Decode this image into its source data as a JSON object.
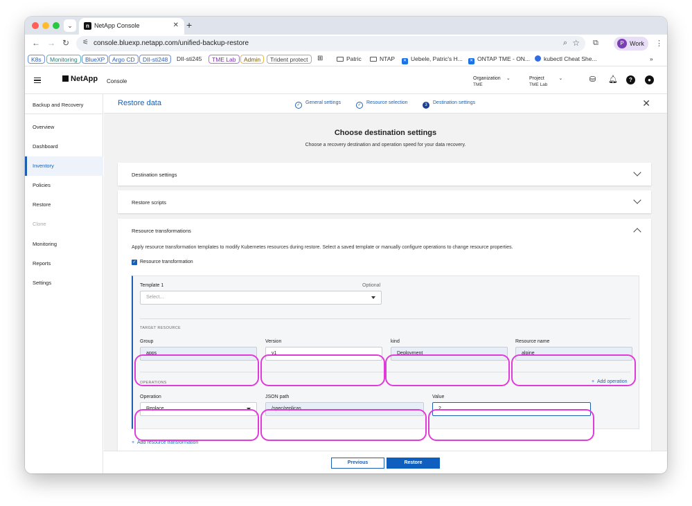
{
  "browser": {
    "tab_title": "NetApp Console",
    "url": "console.bluexp.netapp.com/unified-backup-restore",
    "profile_initial": "P",
    "profile_name": "Work",
    "bookmarks": [
      "K8s",
      "Monitoring",
      "BlueXP",
      "Argo CD",
      "DII-sti248",
      "DII-sti245",
      "TME Lab",
      "Admin",
      "Trident protect",
      "Patric",
      "NTAP",
      "Uebele, Patric's H...",
      "ONTAP TME - ON...",
      "kubectl Cheat She..."
    ]
  },
  "header": {
    "logo": "NetApp",
    "app_name": "Console",
    "organization_label": "Organization",
    "organization_value": "TME",
    "project_label": "Project",
    "project_value": "TME Lab"
  },
  "sidebar": {
    "title": "Backup and Recovery",
    "items": [
      "Overview",
      "Dashboard",
      "Inventory",
      "Policies",
      "Restore",
      "Clone",
      "Monitoring",
      "Reports",
      "Settings"
    ],
    "active": "Inventory",
    "disabled": "Clone"
  },
  "wizard": {
    "title": "Restore data",
    "steps": [
      {
        "label": "General settings",
        "state": "done"
      },
      {
        "label": "Resource selection",
        "state": "done"
      },
      {
        "label": "Destination settings",
        "state": "current",
        "number": "3"
      }
    ]
  },
  "content": {
    "heading": "Choose destination settings",
    "subheading": "Choose a recovery destination and operation speed for your data recovery.",
    "panels": {
      "destination": "Destination settings",
      "scripts": "Restore scripts",
      "transformations": "Resource transformations"
    },
    "transform_desc": "Apply resource transformation templates to modify Kubernetes resources during restore. Select a saved template or manually configure operations to change resource properties.",
    "checkbox_label": "Resource transformation",
    "template_label": "Template 1",
    "template_optional": "Optional",
    "template_placeholder": "Select...",
    "target_section": "TARGET RESOURCE",
    "group_label": "Group",
    "group_value": "apps",
    "version_label": "Version",
    "version_value": "v1",
    "kind_label": "kind",
    "kind_value": "Deployment",
    "resname_label": "Resource name",
    "resname_value": "alpine",
    "operations_section": "OPERATIONS",
    "add_operation": "Add operation",
    "operation_label": "Operation",
    "operation_value": "Replace",
    "jsonpath_label": "JSON path",
    "jsonpath_value": "/spec/replicas",
    "value_label": "Value",
    "value_value": "2",
    "add_transformation": "Add resource transformation"
  },
  "footer": {
    "previous": "Previous",
    "restore": "Restore"
  },
  "colors": {
    "accent": "#1a5fb4",
    "highlight": "#e03ad8"
  }
}
